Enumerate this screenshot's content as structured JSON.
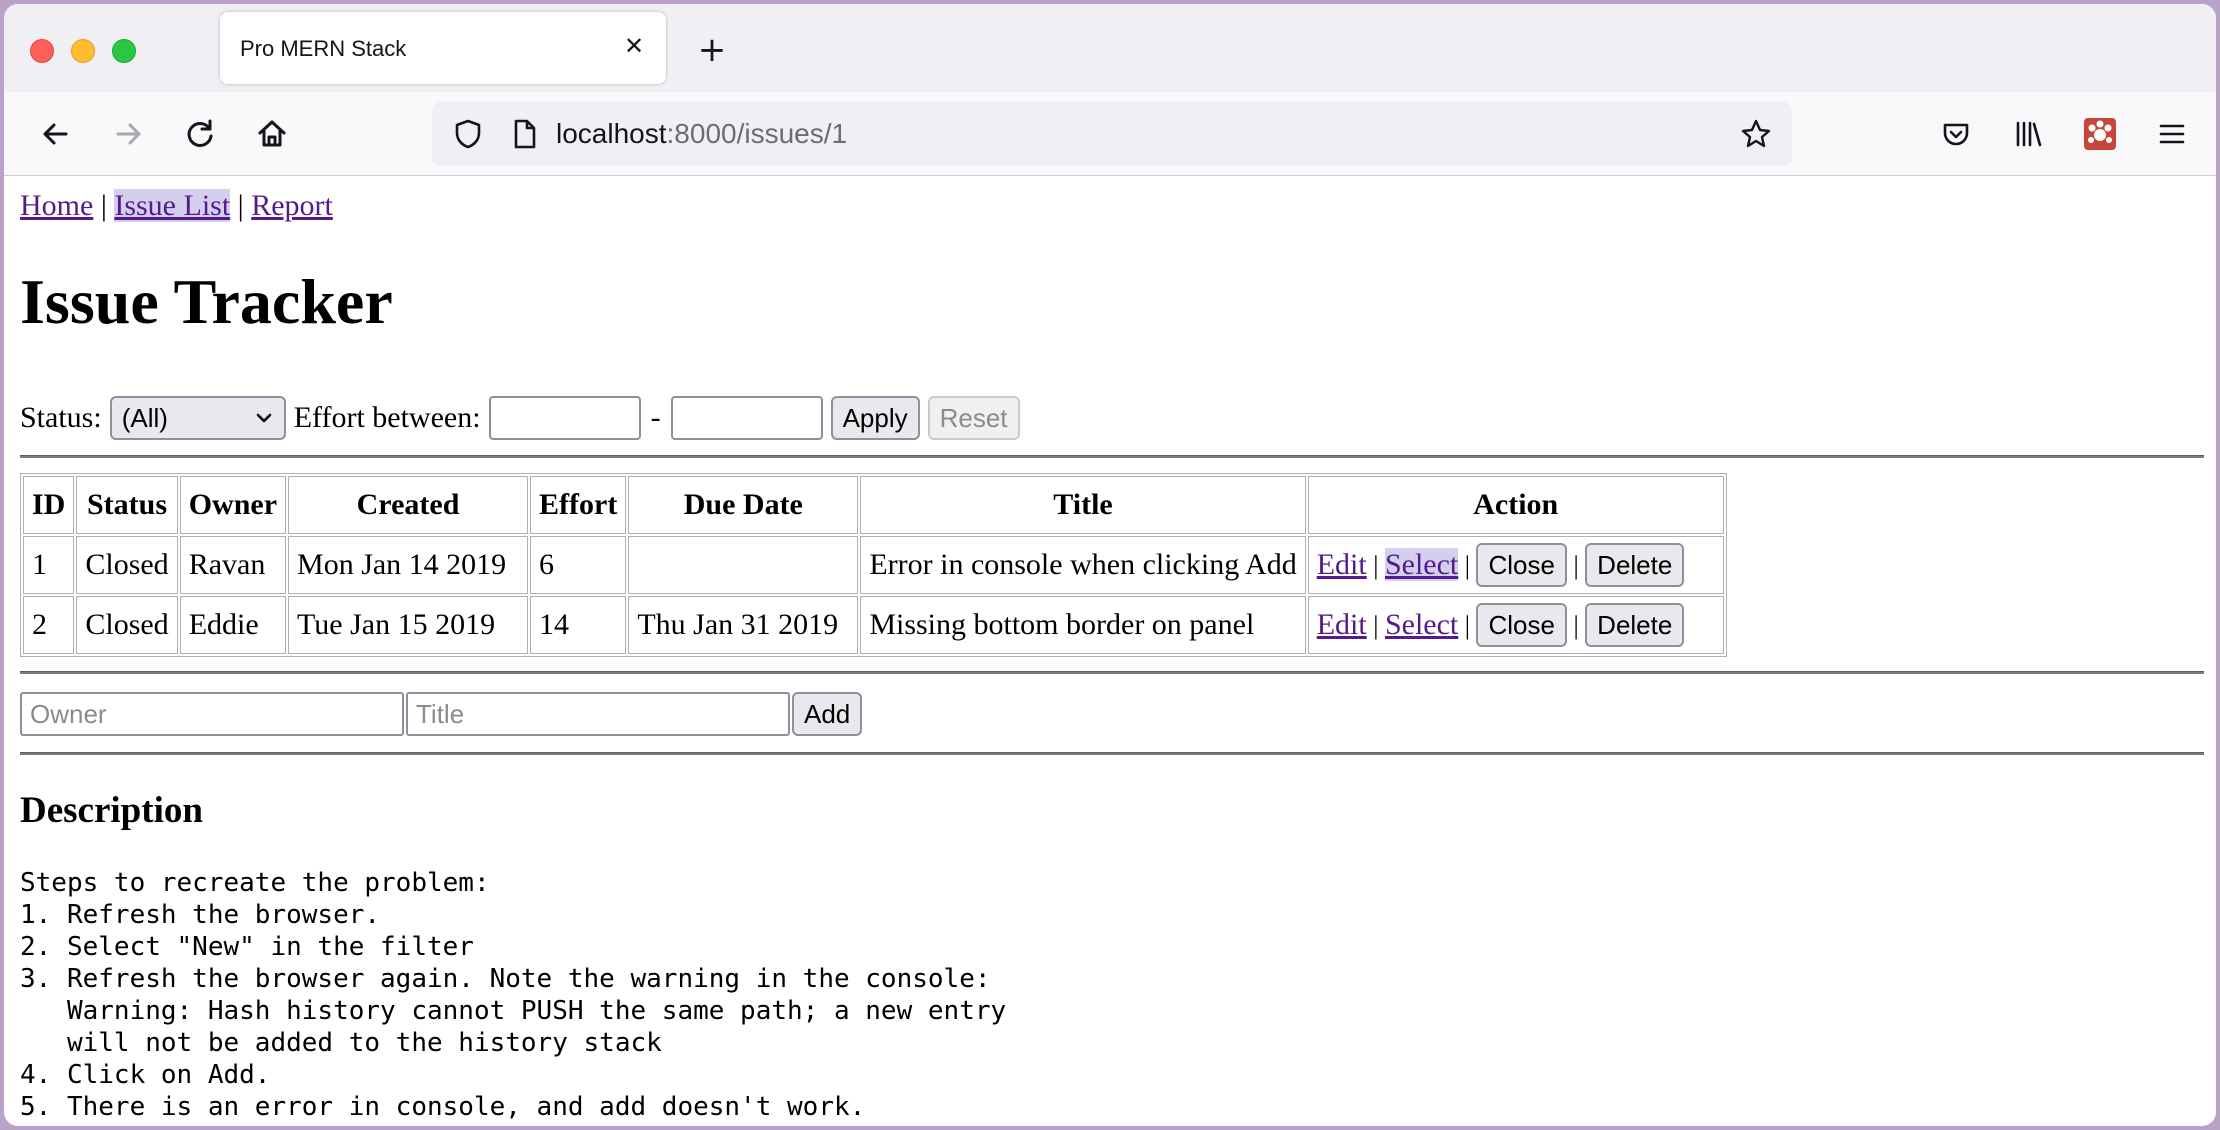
{
  "browser": {
    "tab_title": "Pro MERN Stack",
    "tab_close": "✕",
    "new_tab": "+",
    "url_host": "localhost",
    "url_rest": ":8000/issues/1"
  },
  "nav": {
    "home": "Home",
    "sep1": " | ",
    "issue_list": "Issue List",
    "sep2": " | ",
    "report": "Report"
  },
  "page_title": "Issue Tracker",
  "filter": {
    "status_label": "Status:",
    "status_value": "(All)",
    "effort_label": "Effort between:",
    "dash": "-",
    "apply": "Apply",
    "reset": "Reset"
  },
  "table": {
    "headers": [
      "ID",
      "Status",
      "Owner",
      "Created",
      "Effort",
      "Due Date",
      "Title",
      "Action"
    ],
    "rows": [
      {
        "id": "1",
        "status": "Closed",
        "owner": "Ravan",
        "created": "Mon Jan 14 2019",
        "effort": "6",
        "due": "",
        "title": "Error in console when clicking Add"
      },
      {
        "id": "2",
        "status": "Closed",
        "owner": "Eddie",
        "created": "Tue Jan 15 2019",
        "effort": "14",
        "due": "Thu Jan 31 2019",
        "title": "Missing bottom border on panel"
      }
    ],
    "actions": {
      "edit": "Edit",
      "select": "Select",
      "sep": " | ",
      "close": "Close",
      "delete": "Delete"
    }
  },
  "add_form": {
    "owner_placeholder": "Owner",
    "title_placeholder": "Title",
    "add": "Add"
  },
  "description": {
    "heading": "Description",
    "text": "Steps to recreate the problem:\n1. Refresh the browser.\n2. Select \"New\" in the filter\n3. Refresh the browser again. Note the warning in the console:\n   Warning: Hash history cannot PUSH the same path; a new entry\n   will not be added to the history stack\n4. Click on Add.\n5. There is an error in console, and add doesn't work."
  }
}
